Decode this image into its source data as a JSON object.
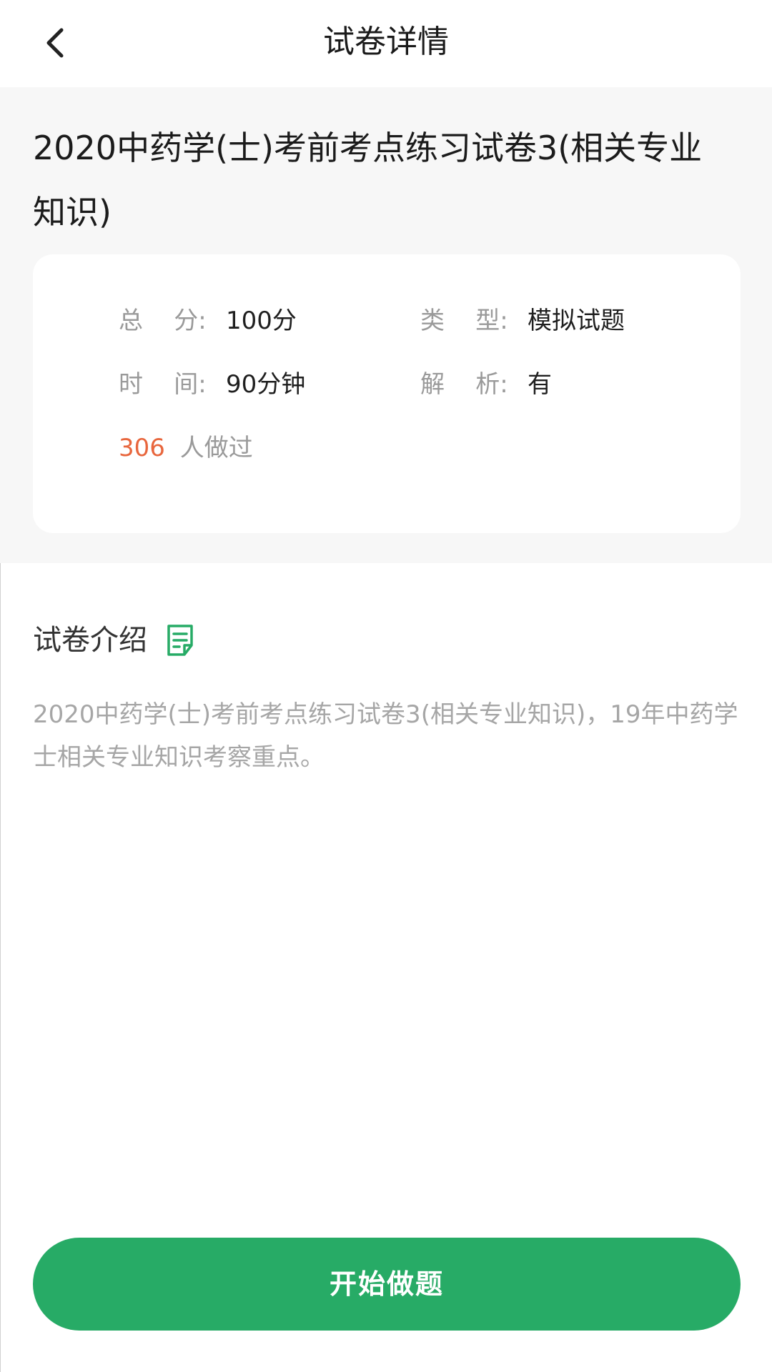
{
  "header": {
    "title": "试卷详情"
  },
  "exam": {
    "title": "2020中药学(士)考前考点练习试卷3(相关专业知识)"
  },
  "info": {
    "score_label": "总    分:",
    "score_value": "100分",
    "type_label": "类    型:",
    "type_value": "模拟试题",
    "time_label": "时    间:",
    "time_value": "90分钟",
    "analysis_label": "解    析:",
    "analysis_value": "有",
    "done_count": "306",
    "done_text": "人做过"
  },
  "intro": {
    "title": "试卷介绍",
    "text": "2020中药学(士)考前考点练习试卷3(相关专业知识)，19年中药学士相关专业知识考察重点。"
  },
  "actions": {
    "start_label": "开始做题"
  },
  "colors": {
    "accent_green": "#27ab66",
    "count_orange": "#e8663d",
    "label_gray": "#9a9a9a",
    "background_gray": "#f7f7f7"
  },
  "icons": {
    "back": "chevron-left-icon",
    "intro": "document-icon"
  }
}
